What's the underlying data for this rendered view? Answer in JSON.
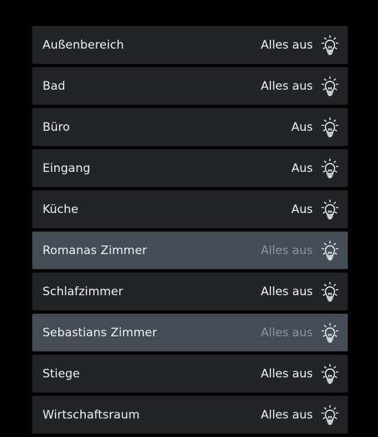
{
  "rooms": [
    {
      "name": "Außenbereich",
      "status": "Alles aus",
      "selected": false,
      "icon": "lightbulb-off-icon"
    },
    {
      "name": "Bad",
      "status": "Alles aus",
      "selected": false,
      "icon": "lightbulb-off-icon"
    },
    {
      "name": "Büro",
      "status": "Aus",
      "selected": false,
      "icon": "lightbulb-off-icon"
    },
    {
      "name": "Eingang",
      "status": "Aus",
      "selected": false,
      "icon": "lightbulb-off-icon"
    },
    {
      "name": "Küche",
      "status": "Aus",
      "selected": false,
      "icon": "lightbulb-off-icon"
    },
    {
      "name": "Romanas Zimmer",
      "status": "Alles aus",
      "selected": true,
      "icon": "lightbulb-off-icon"
    },
    {
      "name": "Schlafzimmer",
      "status": "Alles aus",
      "selected": false,
      "icon": "lightbulb-off-icon"
    },
    {
      "name": "Sebastians Zimmer",
      "status": "Alles aus",
      "selected": true,
      "icon": "lightbulb-off-icon"
    },
    {
      "name": "Stiege",
      "status": "Alles aus",
      "selected": false,
      "icon": "lightbulb-off-icon"
    },
    {
      "name": "Wirtschaftsraum",
      "status": "Alles aus",
      "selected": false,
      "icon": "lightbulb-off-icon"
    }
  ],
  "colors": {
    "background": "#000000",
    "row": "#222428",
    "row_selected": "#454c55",
    "text": "#f2f2f2",
    "status_selected": "#8d959f"
  }
}
